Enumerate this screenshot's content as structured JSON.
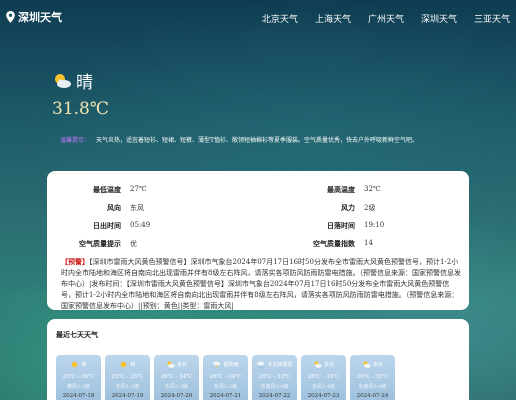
{
  "header": {
    "city_title": "深圳天气",
    "nav": [
      "北京天气",
      "上海天气",
      "广州天气",
      "深圳天气",
      "三亚天气"
    ]
  },
  "current": {
    "condition": "晴",
    "temperature": "31.8℃",
    "icon": "sun-cloud-icon"
  },
  "tip": {
    "label": "温馨提示：",
    "text": "天气炎热，适宜着短衫、短裙、短裤、薄型T恤衫、敞领短袖棉衫等夏季服装。空气质量优秀，快去户外呼吸新鲜空气吧。"
  },
  "details": {
    "left": [
      {
        "k": "最低温度",
        "v": "27℃"
      },
      {
        "k": "风向",
        "v": "东风"
      },
      {
        "k": "日出时间",
        "v": "05:49"
      },
      {
        "k": "空气质量提示",
        "v": "优"
      }
    ],
    "right": [
      {
        "k": "最高温度",
        "v": "32℃"
      },
      {
        "k": "风力",
        "v": "2级"
      },
      {
        "k": "日落时间",
        "v": "19:10"
      },
      {
        "k": "空气质量指数",
        "v": "14"
      }
    ]
  },
  "alert": {
    "tag": "【预警】",
    "text": "【深圳市雷雨大风黄色预警信号】深圳市气象台2024年07月17日16时50分发布全市雷雨大风黄色预警信号，预计1-2小时内全市陆地和海区将自南向北出现雷雨并伴有8级左右阵风，请落实各项防风防雨防雷电措施。（预警信息来源：国家预警信息发布中心）|发布时间：【深圳市雷雨大风黄色预警信号】深圳市气象台2024年07月17日16时50分发布全市雷雨大风黄色预警信号，预计1-2小时内全市陆地和海区将自南向北出现雷雨并伴有8级左右阵风，请落实各项防风防雨防雷电措施。（预警信息来源：国家预警信息发布中心）||预别：黄色||类型：雷雨大风|"
  },
  "week": {
    "title": "最近七天天气",
    "days": [
      {
        "cond": "晴",
        "temp": "25℃ - 36℃",
        "wind": "微风2-3级",
        "date": "2024-07-18",
        "icon": "sun-icon"
      },
      {
        "cond": "晴",
        "temp": "25℃ - 35℃",
        "wind": "东风1-2级",
        "date": "2024-07-19",
        "icon": "sun-icon"
      },
      {
        "cond": "多云",
        "temp": "26℃ - 34℃",
        "wind": "东风2-3级",
        "date": "2024-07-20",
        "icon": "cloud-icon"
      },
      {
        "cond": "雷阵雨",
        "temp": "26℃ - 34℃",
        "wind": "东风2-3级",
        "date": "2024-07-21",
        "icon": "thunder-icon"
      },
      {
        "cond": "多云转雷阵",
        "temp": "26℃ - 33℃",
        "wind": "东南风3-4级",
        "date": "2024-07-22",
        "icon": "cloud-rain-icon"
      },
      {
        "cond": "多云",
        "temp": "26℃ - 33℃",
        "wind": "东风3-4级",
        "date": "2024-07-23",
        "icon": "cloud-icon"
      },
      {
        "cond": "多云",
        "temp": "26℃ - 33℃",
        "wind": "东南风3-4级",
        "date": "2024-07-24",
        "icon": "cloud-icon"
      }
    ]
  }
}
